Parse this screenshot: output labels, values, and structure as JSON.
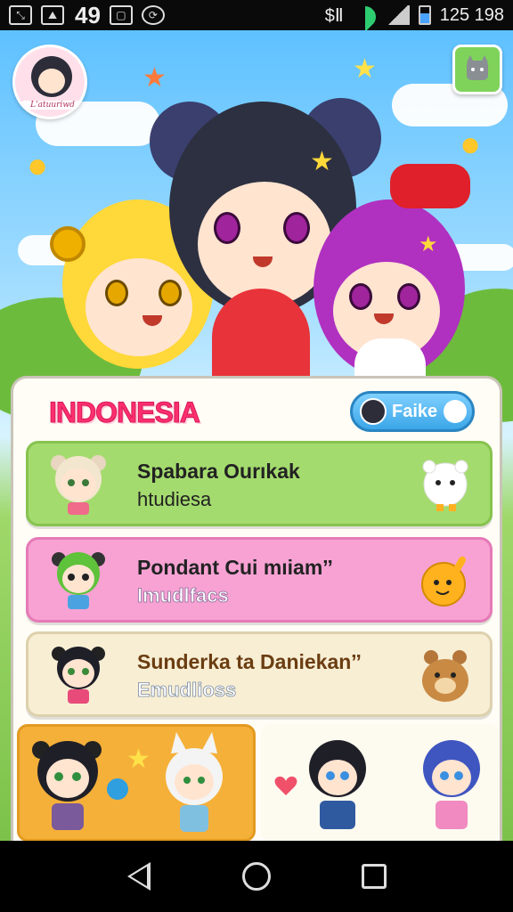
{
  "status_bar": {
    "left_number": "49",
    "right_text": "125 198",
    "network_label": "$Ⅱ"
  },
  "app": {
    "avatar_label": "L'atuuriwd",
    "panel": {
      "title": "INDONESIA",
      "pill_button_label": "Faike"
    },
    "cards": [
      {
        "title": "Spabara Ourıkak",
        "subtitle": "htudiesa",
        "color": "#a4db6e"
      },
      {
        "title": "Pondant Cui mıiamˮ",
        "subtitle": "Imudlfacs",
        "color": "#f7a2d3"
      },
      {
        "title": "Sunderka ta Daniekanˮ",
        "subtitle": "Emudlioss",
        "color": "#f7eed4"
      }
    ]
  },
  "icons": {
    "back": "back-triangle-icon",
    "home": "home-circle-icon",
    "recents": "recents-square-icon"
  }
}
